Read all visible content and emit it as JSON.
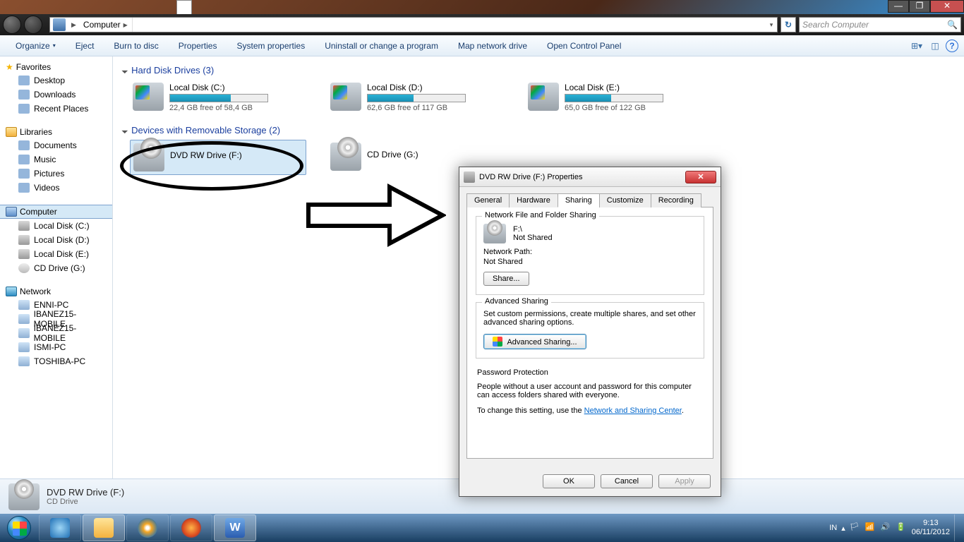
{
  "window": {
    "breadcrumb_root": "Computer",
    "search_placeholder": "Search Computer"
  },
  "toolbar": {
    "items": [
      "Organize",
      "Eject",
      "Burn to disc",
      "Properties",
      "System properties",
      "Uninstall or change a program",
      "Map network drive",
      "Open Control Panel"
    ]
  },
  "sidebar": {
    "favorites": {
      "title": "Favorites",
      "items": [
        "Desktop",
        "Downloads",
        "Recent Places"
      ]
    },
    "libraries": {
      "title": "Libraries",
      "items": [
        "Documents",
        "Music",
        "Pictures",
        "Videos"
      ]
    },
    "computer": {
      "title": "Computer",
      "items": [
        "Local Disk (C:)",
        "Local Disk (D:)",
        "Local Disk (E:)",
        "CD Drive (G:)"
      ]
    },
    "network": {
      "title": "Network",
      "items": [
        "ENNI-PC",
        "IBANEZ15-MOBILE",
        "IBANEZ15-MOBILE",
        "ISMI-PC",
        "TOSHIBA-PC"
      ]
    }
  },
  "groups": {
    "hdd_title": "Hard Disk Drives (3)",
    "removable_title": "Devices with Removable Storage (2)"
  },
  "drives": {
    "hdd": [
      {
        "name": "Local Disk (C:)",
        "free": "22,4 GB free of 58,4 GB",
        "fill_pct": 62
      },
      {
        "name": "Local Disk (D:)",
        "free": "62,6 GB free of 117 GB",
        "fill_pct": 47
      },
      {
        "name": "Local Disk (E:)",
        "free": "65,0 GB free of 122 GB",
        "fill_pct": 47
      }
    ],
    "removable": [
      {
        "name": "DVD RW Drive (F:)"
      },
      {
        "name": "CD Drive (G:)"
      }
    ]
  },
  "status": {
    "title": "DVD RW Drive (F:)",
    "subtitle": "CD Drive"
  },
  "dialog": {
    "title": "DVD RW Drive (F:) Properties",
    "tabs": [
      "General",
      "Hardware",
      "Sharing",
      "Customize",
      "Recording"
    ],
    "active_tab": "Sharing",
    "sharing": {
      "group1_title": "Network File and Folder Sharing",
      "drive_path": "F:\\",
      "drive_status": "Not Shared",
      "network_path_label": "Network Path:",
      "network_path_value": "Not Shared",
      "share_btn": "Share...",
      "group2_title": "Advanced Sharing",
      "group2_desc": "Set custom permissions, create multiple shares, and set other advanced sharing options.",
      "adv_btn": "Advanced Sharing...",
      "group3_title": "Password Protection",
      "group3_desc1": "People without a user account and password for this computer can access folders shared with everyone.",
      "group3_desc2_pre": "To change this setting, use the ",
      "group3_link": "Network and Sharing Center",
      "group3_desc2_post": "."
    },
    "buttons": {
      "ok": "OK",
      "cancel": "Cancel",
      "apply": "Apply"
    }
  },
  "tray": {
    "lang": "IN",
    "time": "9:13",
    "date": "06/11/2012"
  }
}
